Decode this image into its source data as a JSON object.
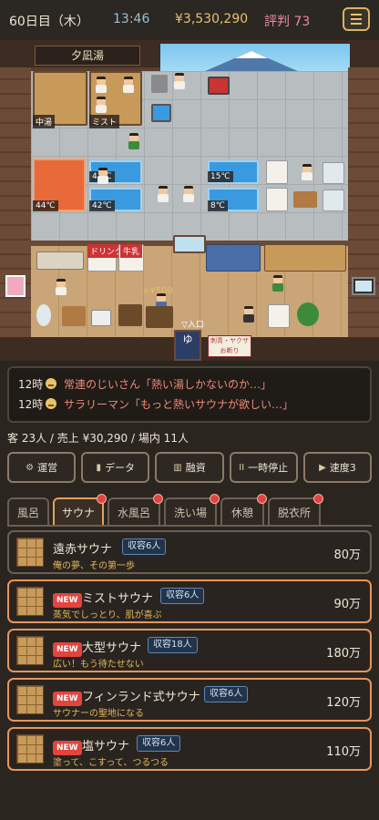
{
  "status": {
    "day": "60日目（木）",
    "time": "13:46",
    "money": "¥3,530,290",
    "reputation": "評判 73"
  },
  "map": {
    "bath_name": "夕凪湯",
    "labels": {
      "chuyu": "中湯",
      "mist": "ミスト",
      "temp_left_top": "41℃",
      "temp_left_mid": "42℃",
      "temp_hot": "44℃",
      "temp_right_top": "15℃",
      "temp_right_mid": "8℃",
      "drink": "ドリンク",
      "milk": "牛乳",
      "entrance_sign": "ゆ",
      "entrance_label": "▽入口",
      "notice": "刺青・ヤクザ お断り",
      "float_money": "+¥500",
      "float_small": "+¥500"
    }
  },
  "log": [
    {
      "time": "12時",
      "text": "常連のじいさん「熱い湯しかないのか…」"
    },
    {
      "time": "12時",
      "text": "サラリーマン「もっと熱いサウナが欲しい…」"
    }
  ],
  "stats": "客 23人 / 売上 ¥30,290 / 場内 11人",
  "actions": [
    {
      "icon": "⚙",
      "label": "運営"
    },
    {
      "icon": "▮",
      "label": "データ"
    },
    {
      "icon": "▥",
      "label": "融資"
    },
    {
      "icon": "II",
      "label": "一時停止"
    },
    {
      "icon": "▶",
      "label": "速度3"
    }
  ],
  "tabs": [
    {
      "label": "風呂",
      "dot": false,
      "active": false
    },
    {
      "label": "サウナ",
      "dot": true,
      "active": true
    },
    {
      "label": "水風呂",
      "dot": true,
      "active": false
    },
    {
      "label": "洗い場",
      "dot": true,
      "active": false
    },
    {
      "label": "休憩",
      "dot": true,
      "active": false
    },
    {
      "label": "脱衣所",
      "dot": true,
      "active": false
    }
  ],
  "items": [
    {
      "new": false,
      "badge": "",
      "name": "遠赤サウナ",
      "capacity": "収容6人",
      "desc": "俺の夢、その第一歩",
      "price": "80万"
    },
    {
      "new": true,
      "badge": "NEW",
      "name": "ミストサウナ",
      "capacity": "収容6人",
      "desc": "蒸気でしっとり、肌が喜ぶ",
      "price": "90万"
    },
    {
      "new": true,
      "badge": "NEW",
      "name": "大型サウナ",
      "capacity": "収容18人",
      "desc": "広い！もう待たせない",
      "price": "180万"
    },
    {
      "new": true,
      "badge": "NEW",
      "name": "フィンランド式サウナ",
      "capacity": "収容6人",
      "desc": "サウナーの聖地になる",
      "price": "120万"
    },
    {
      "new": true,
      "badge": "NEW",
      "name": "塩サウナ",
      "capacity": "収容6人",
      "desc": "塗って、こすって、つるつる",
      "price": "110万"
    }
  ]
}
